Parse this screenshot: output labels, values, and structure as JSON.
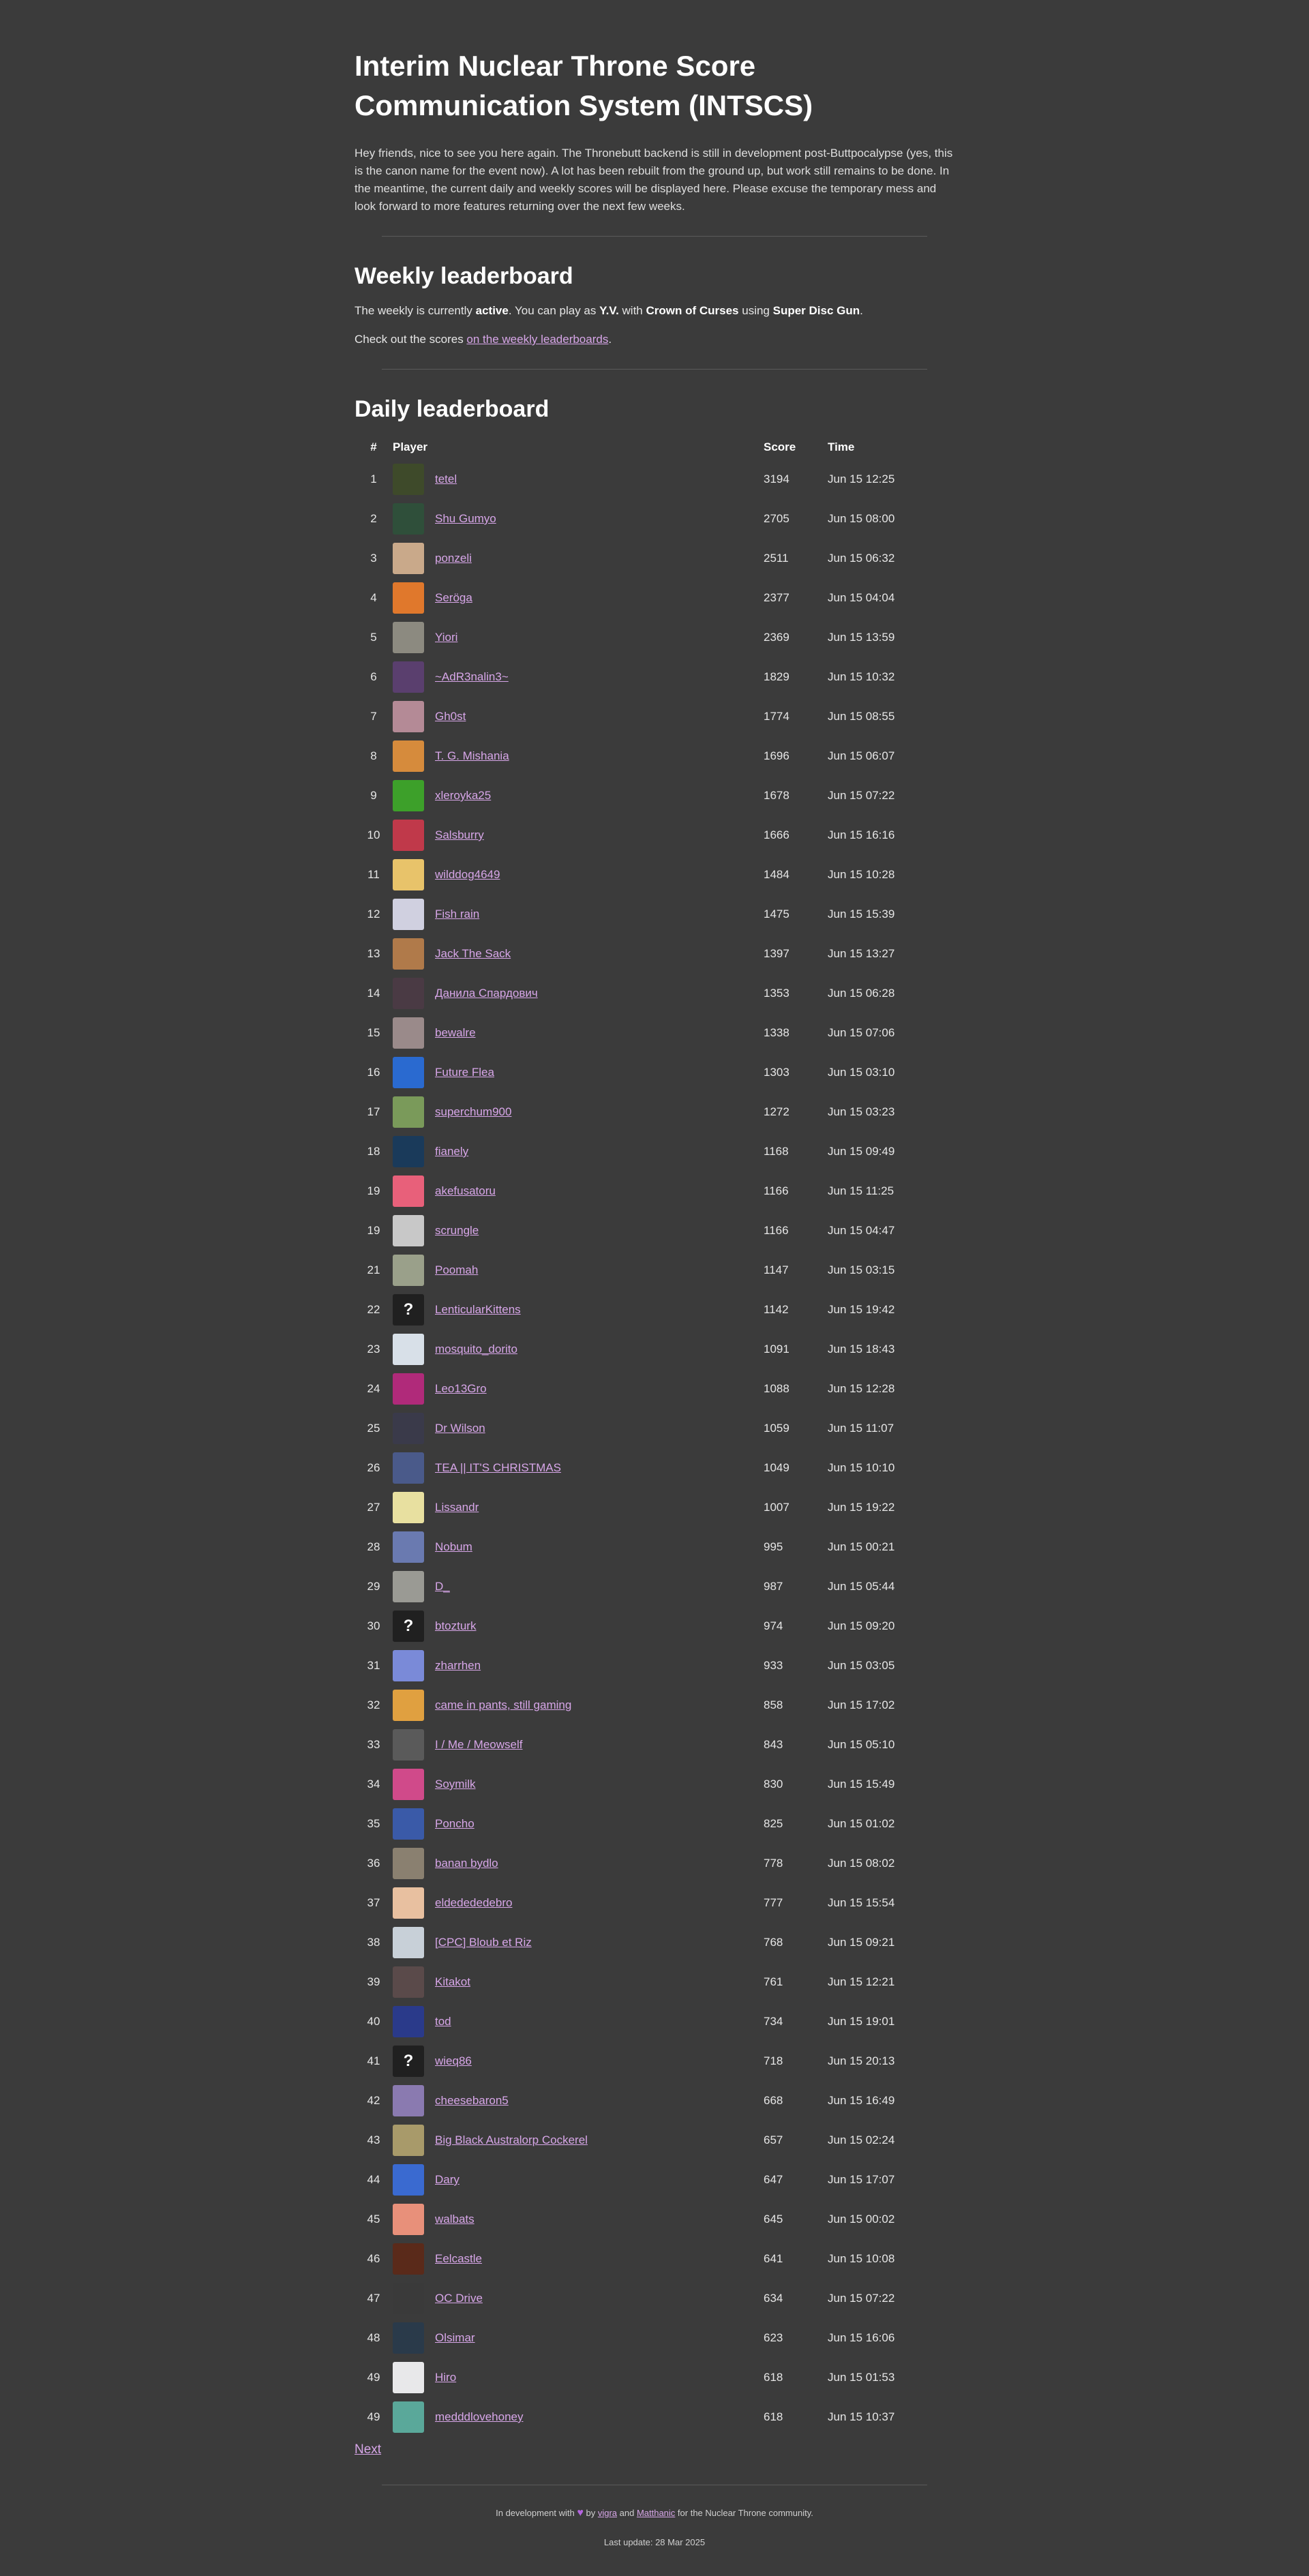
{
  "title": "Interim Nuclear Throne Score Communication System (INTSCS)",
  "intro": "Hey friends, nice to see you here again. The Thronebutt backend is still in development post-Buttpocalypse (yes, this is the canon name for the event now). A lot has been rebuilt from the ground up, but work still remains to be done. In the meantime, the current daily and weekly scores will be displayed here. Please excuse the temporary mess and look forward to more features returning over the next few weeks.",
  "weekly": {
    "heading": "Weekly leaderboard",
    "s1": "The weekly is currently ",
    "status": "active",
    "s2": ". You can play as ",
    "character": "Y.V.",
    "s3": " with ",
    "crown": "Crown of Curses",
    "s4": " using ",
    "weapon": "Super Disc Gun",
    "s5": ".",
    "check_prefix": "Check out the scores ",
    "check_link": "on the weekly leaderboards",
    "check_suffix": "."
  },
  "daily": {
    "heading": "Daily leaderboard",
    "columns": {
      "rank": "#",
      "player": "Player",
      "score": "Score",
      "time": "Time"
    },
    "rows": [
      {
        "rank": "1",
        "player": "tetel",
        "score": "3194",
        "time": "Jun 15 12:25",
        "color": "#3e4a2a"
      },
      {
        "rank": "2",
        "player": "Shu Gumyo",
        "score": "2705",
        "time": "Jun 15 08:00",
        "color": "#2f4f3a"
      },
      {
        "rank": "3",
        "player": "ponzeli",
        "score": "2511",
        "time": "Jun 15 06:32",
        "color": "#c9a98a"
      },
      {
        "rank": "4",
        "player": "Seröga",
        "score": "2377",
        "time": "Jun 15 04:04",
        "color": "#e0782c"
      },
      {
        "rank": "5",
        "player": "Yiori",
        "score": "2369",
        "time": "Jun 15 13:59",
        "color": "#8c8a80"
      },
      {
        "rank": "6",
        "player": "~AdR3nalin3~",
        "score": "1829",
        "time": "Jun 15 10:32",
        "color": "#5a3f6e"
      },
      {
        "rank": "7",
        "player": "Gh0st",
        "score": "1774",
        "time": "Jun 15 08:55",
        "color": "#b48a96"
      },
      {
        "rank": "8",
        "player": "T. G. Mishania",
        "score": "1696",
        "time": "Jun 15 06:07",
        "color": "#d68b3c"
      },
      {
        "rank": "9",
        "player": "xleroyka25",
        "score": "1678",
        "time": "Jun 15 07:22",
        "color": "#3da02a"
      },
      {
        "rank": "10",
        "player": "Salsburry",
        "score": "1666",
        "time": "Jun 15 16:16",
        "color": "#c0394a"
      },
      {
        "rank": "11",
        "player": "wilddog4649",
        "score": "1484",
        "time": "Jun 15 10:28",
        "color": "#e8c36a"
      },
      {
        "rank": "12",
        "player": "Fish rain",
        "score": "1475",
        "time": "Jun 15 15:39",
        "color": "#d0d0e0"
      },
      {
        "rank": "13",
        "player": "Jack The Sack",
        "score": "1397",
        "time": "Jun 15 13:27",
        "color": "#b07a4a"
      },
      {
        "rank": "14",
        "player": "Данила Спардович",
        "score": "1353",
        "time": "Jun 15 06:28",
        "color": "#4a3a44"
      },
      {
        "rank": "15",
        "player": "bewalre",
        "score": "1338",
        "time": "Jun 15 07:06",
        "color": "#9a8a8a"
      },
      {
        "rank": "16",
        "player": "Future Flea",
        "score": "1303",
        "time": "Jun 15 03:10",
        "color": "#2a6ad0"
      },
      {
        "rank": "17",
        "player": "superchum900",
        "score": "1272",
        "time": "Jun 15 03:23",
        "color": "#7a9a5a"
      },
      {
        "rank": "18",
        "player": "fianely",
        "score": "1168",
        "time": "Jun 15 09:49",
        "color": "#1a3a5a"
      },
      {
        "rank": "19",
        "player": "akefusatoru",
        "score": "1166",
        "time": "Jun 15 11:25",
        "color": "#e8607a"
      },
      {
        "rank": "19",
        "player": "scrungle",
        "score": "1166",
        "time": "Jun 15 04:47",
        "color": "#c8c8c8"
      },
      {
        "rank": "21",
        "player": "Poomah",
        "score": "1147",
        "time": "Jun 15 03:15",
        "color": "#9aa08a"
      },
      {
        "rank": "22",
        "player": "LenticularKittens",
        "score": "1142",
        "time": "Jun 15 19:42",
        "color": "#202020",
        "glyph": "?"
      },
      {
        "rank": "23",
        "player": "mosquito_dorito",
        "score": "1091",
        "time": "Jun 15 18:43",
        "color": "#d8e0e8"
      },
      {
        "rank": "24",
        "player": "Leo13Gro",
        "score": "1088",
        "time": "Jun 15 12:28",
        "color": "#b02a7a"
      },
      {
        "rank": "25",
        "player": "Dr Wilson",
        "score": "1059",
        "time": "Jun 15 11:07",
        "color": "#3a3a4a"
      },
      {
        "rank": "26",
        "player": "TEA || IT'S CHRISTMAS",
        "score": "1049",
        "time": "Jun 15 10:10",
        "color": "#4a5a8a"
      },
      {
        "rank": "27",
        "player": "Lissandr",
        "score": "1007",
        "time": "Jun 15 19:22",
        "color": "#e8e0a0"
      },
      {
        "rank": "28",
        "player": "Nobum",
        "score": "995",
        "time": "Jun 15 00:21",
        "color": "#6a7ab0"
      },
      {
        "rank": "29",
        "player": "D_",
        "score": "987",
        "time": "Jun 15 05:44",
        "color": "#9a9a94"
      },
      {
        "rank": "30",
        "player": "btozturk",
        "score": "974",
        "time": "Jun 15 09:20",
        "color": "#202020",
        "glyph": "?"
      },
      {
        "rank": "31",
        "player": "zharrhen",
        "score": "933",
        "time": "Jun 15 03:05",
        "color": "#7a8ad8"
      },
      {
        "rank": "32",
        "player": "came in pants, still gaming",
        "score": "858",
        "time": "Jun 15 17:02",
        "color": "#e0a040"
      },
      {
        "rank": "33",
        "player": "I / Me / Meowself",
        "score": "843",
        "time": "Jun 15 05:10",
        "color": "#5a5a5a"
      },
      {
        "rank": "34",
        "player": "Soymilk",
        "score": "830",
        "time": "Jun 15 15:49",
        "color": "#d04a8a"
      },
      {
        "rank": "35",
        "player": "Poncho",
        "score": "825",
        "time": "Jun 15 01:02",
        "color": "#3a5aa8"
      },
      {
        "rank": "36",
        "player": "banan bydlo",
        "score": "778",
        "time": "Jun 15 08:02",
        "color": "#8a8070"
      },
      {
        "rank": "37",
        "player": "eldedededebro",
        "score": "777",
        "time": "Jun 15 15:54",
        "color": "#e8c0a0"
      },
      {
        "rank": "38",
        "player": "[CPC] Bloub et Riz",
        "score": "768",
        "time": "Jun 15 09:21",
        "color": "#c8d0d8"
      },
      {
        "rank": "39",
        "player": "Kitakot",
        "score": "761",
        "time": "Jun 15 12:21",
        "color": "#5a4a4a"
      },
      {
        "rank": "40",
        "player": "tod",
        "score": "734",
        "time": "Jun 15 19:01",
        "color": "#2a3a8a"
      },
      {
        "rank": "41",
        "player": "wieq86",
        "score": "718",
        "time": "Jun 15 20:13",
        "color": "#202020",
        "glyph": "?"
      },
      {
        "rank": "42",
        "player": "cheesebaron5",
        "score": "668",
        "time": "Jun 15 16:49",
        "color": "#8a7ab0"
      },
      {
        "rank": "43",
        "player": "Big Black Australorp Cockerel",
        "score": "657",
        "time": "Jun 15 02:24",
        "color": "#a89a6a"
      },
      {
        "rank": "44",
        "player": "Dary",
        "score": "647",
        "time": "Jun 15 17:07",
        "color": "#3a6ad0"
      },
      {
        "rank": "45",
        "player": "walbats",
        "score": "645",
        "time": "Jun 15 00:02",
        "color": "#e8907a"
      },
      {
        "rank": "46",
        "player": "Eelcastle",
        "score": "641",
        "time": "Jun 15 10:08",
        "color": "#5a2a1a"
      },
      {
        "rank": "47",
        "player": "OC Drive",
        "score": "634",
        "time": "Jun 15 07:22",
        "color": "#3a3a3a"
      },
      {
        "rank": "48",
        "player": "Olsimar",
        "score": "623",
        "time": "Jun 15 16:06",
        "color": "#2a3a4a"
      },
      {
        "rank": "49",
        "player": "Hiro",
        "score": "618",
        "time": "Jun 15 01:53",
        "color": "#e8e8ea"
      },
      {
        "rank": "49",
        "player": "medddlovehoney",
        "score": "618",
        "time": "Jun 15 10:37",
        "color": "#5aa89a"
      }
    ],
    "next_label": "Next"
  },
  "footer": {
    "prefix": "In development with ",
    "heart": "♥",
    "by": " by ",
    "author1": "vigra",
    "and": " and ",
    "author2": "Matthanic",
    "suffix": " for the Nuclear Throne community.",
    "last_update": "Last update: 28 Mar 2025"
  },
  "colors": {
    "background": "#3b3b3b",
    "link": "#d7a6e8",
    "heart": "#b565e0"
  }
}
